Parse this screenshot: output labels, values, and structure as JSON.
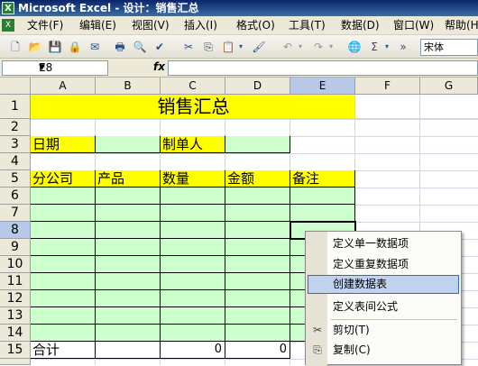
{
  "window": {
    "title": "Microsoft Excel - 设计：销售汇总",
    "app_icon": "excel-icon"
  },
  "menus": [
    "文件(F)",
    "编辑(E)",
    "视图(V)",
    "插入(I)",
    "格式(O)",
    "工具(T)",
    "数据(D)",
    "窗口(W)",
    "帮助(H)"
  ],
  "toolbar": {
    "font_name": "宋体",
    "more": "»"
  },
  "formula_bar": {
    "name_box": "E8",
    "fx": "fx",
    "content": ""
  },
  "columns": [
    "A",
    "B",
    "C",
    "D",
    "E",
    "F",
    "G"
  ],
  "selected_column": "E",
  "rows": [
    "1",
    "2",
    "3",
    "4",
    "5",
    "6",
    "7",
    "8",
    "9",
    "10",
    "11",
    "12",
    "13",
    "14",
    "15"
  ],
  "selected_row": "8",
  "sheet": {
    "title": "销售汇总",
    "date_label": "日期",
    "maker_label": "制单人",
    "headers": [
      "分公司",
      "产品",
      "数量",
      "金额",
      "备注"
    ],
    "total_label": "合计",
    "total_qty": "0",
    "total_amount": "0"
  },
  "context_menu": {
    "items": [
      "定义单一数据项",
      "定义重复数据项",
      "创建数据表",
      "定义表间公式",
      "剪切(T)",
      "复制(C)"
    ],
    "highlighted": "创建数据表"
  },
  "colors": {
    "title_fill": "#ffff00",
    "input_fill": "#ccffcc",
    "selection": "#b7c8e8",
    "titlebar": "#0a246a"
  }
}
